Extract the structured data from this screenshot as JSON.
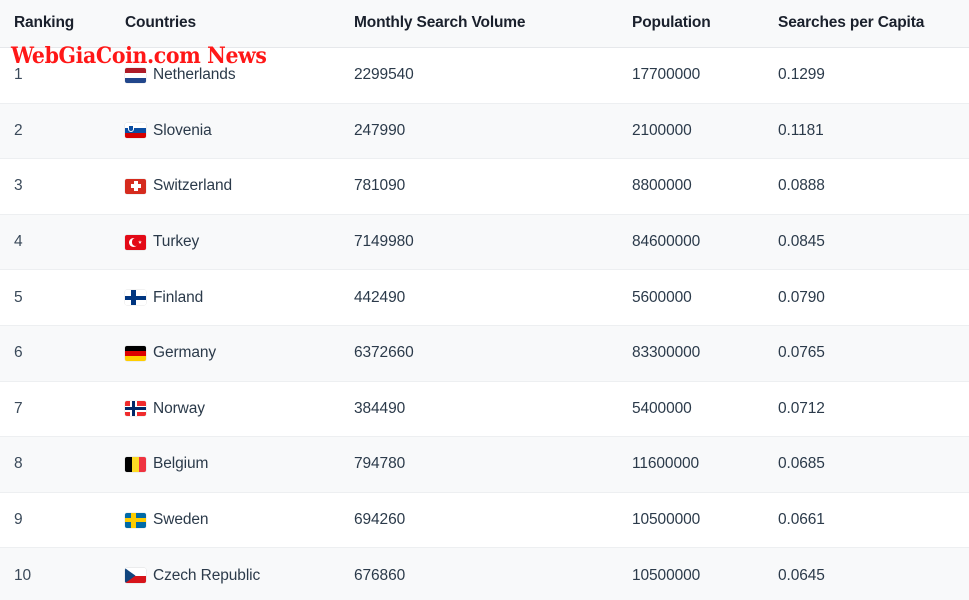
{
  "watermark": {
    "text": "WebGiaCoin.com News",
    "color": "#ff1717"
  },
  "table": {
    "columns": [
      {
        "key": "ranking",
        "label": "Ranking"
      },
      {
        "key": "country",
        "label": "Countries"
      },
      {
        "key": "monthly_search_volume",
        "label": "Monthly Search Volume"
      },
      {
        "key": "population",
        "label": "Population"
      },
      {
        "key": "searches_per_capita",
        "label": "Searches per Capita"
      }
    ],
    "header_background": "#f8f9fa",
    "stripe_background": "#f8f9fa",
    "row_background": "#ffffff",
    "text_color": "#2b3a4a",
    "header_text_color": "#1a202c",
    "rows": [
      {
        "ranking": "1",
        "flag": "flag-netherlands",
        "country": "Netherlands",
        "monthly_search_volume": "2299540",
        "population": "17700000",
        "searches_per_capita": "0.1299"
      },
      {
        "ranking": "2",
        "flag": "flag-slovenia",
        "country": "Slovenia",
        "monthly_search_volume": "247990",
        "population": "2100000",
        "searches_per_capita": "0.1181"
      },
      {
        "ranking": "3",
        "flag": "flag-switzerland",
        "country": "Switzerland",
        "monthly_search_volume": "781090",
        "population": "8800000",
        "searches_per_capita": "0.0888"
      },
      {
        "ranking": "4",
        "flag": "flag-turkey",
        "country": "Turkey",
        "monthly_search_volume": "7149980",
        "population": "84600000",
        "searches_per_capita": "0.0845"
      },
      {
        "ranking": "5",
        "flag": "flag-finland",
        "country": "Finland",
        "monthly_search_volume": "442490",
        "population": "5600000",
        "searches_per_capita": "0.0790"
      },
      {
        "ranking": "6",
        "flag": "flag-germany",
        "country": "Germany",
        "monthly_search_volume": "6372660",
        "population": "83300000",
        "searches_per_capita": "0.0765"
      },
      {
        "ranking": "7",
        "flag": "flag-norway",
        "country": "Norway",
        "monthly_search_volume": "384490",
        "population": "5400000",
        "searches_per_capita": "0.0712"
      },
      {
        "ranking": "8",
        "flag": "flag-belgium",
        "country": "Belgium",
        "monthly_search_volume": "794780",
        "population": "11600000",
        "searches_per_capita": "0.0685"
      },
      {
        "ranking": "9",
        "flag": "flag-sweden",
        "country": "Sweden",
        "monthly_search_volume": "694260",
        "population": "10500000",
        "searches_per_capita": "0.0661"
      },
      {
        "ranking": "10",
        "flag": "flag-czech-republic",
        "country": "Czech Republic",
        "monthly_search_volume": "676860",
        "population": "10500000",
        "searches_per_capita": "0.0645"
      }
    ]
  }
}
